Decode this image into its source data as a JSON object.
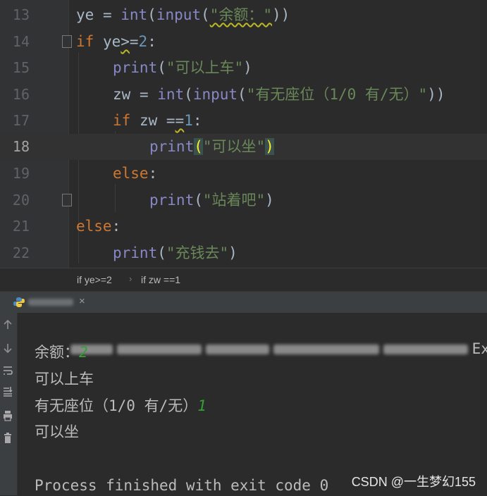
{
  "editor": {
    "line_numbers": [
      "13",
      "14",
      "15",
      "16",
      "17",
      "18",
      "19",
      "20",
      "21",
      "22"
    ],
    "l13": {
      "var": "ye",
      "eq": " = ",
      "fn1": "int",
      "p1": "(",
      "fn2": "input",
      "p2": "(",
      "str": "\"余额：\"",
      "p3": "))"
    },
    "l14": {
      "kw": "if",
      "var": " ye",
      "op": ">",
      "op2": "=",
      "num": "2",
      "colon": ":"
    },
    "l15": {
      "fn": "print",
      "p1": "(",
      "str": "\"可以上车\"",
      "p2": ")"
    },
    "l16": {
      "var": "zw",
      "eq": " = ",
      "fn1": "int",
      "p1": "(",
      "fn2": "input",
      "p2": "(",
      "str": "\"有无座位（1/0 有/无）\"",
      "p3": "))"
    },
    "l17": {
      "kw": "if",
      "var": " zw ",
      "op1": "=",
      "op2": "=",
      "num": "1",
      "colon": ":"
    },
    "l18": {
      "fn": "print",
      "p1": "(",
      "str": "\"可以坐\"",
      "p2": ")"
    },
    "l19": {
      "kw": "else",
      "colon": ":"
    },
    "l20": {
      "fn": "print",
      "p1": "(",
      "str": "\"站着吧\"",
      "p2": ")"
    },
    "l21": {
      "kw": "else",
      "colon": ":"
    },
    "l22": {
      "fn": "print",
      "p1": "(",
      "str": "\"充钱去\"",
      "p2": ")"
    }
  },
  "breadcrumb": {
    "item1": "if ye>=2",
    "separator": "›",
    "item2": "if zw ==1"
  },
  "run_tab": {
    "icon": "python-icon",
    "close": "×"
  },
  "console": {
    "cmd_tail": "Ex",
    "line1_label": "余额：",
    "line1_input": "2",
    "line2": "可以上车",
    "line3_label": "有无座位（1/0 有/无）",
    "line3_input": "1",
    "line4": "可以坐",
    "exit": "Process finished with exit code 0"
  },
  "toolbar_icons": [
    "rerun-up-icon",
    "rerun-down-icon",
    "soft-wrap-icon",
    "scroll-to-end-icon",
    "print-icon",
    "trash-icon"
  ],
  "watermark": "CSDN @一生梦幻155",
  "colors": {
    "keyword": "#cc7832",
    "number": "#6897bb",
    "string": "#6a8759",
    "builtin": "#8888c6",
    "identifier": "#a9b7c6",
    "input_echo": "#33a033"
  }
}
